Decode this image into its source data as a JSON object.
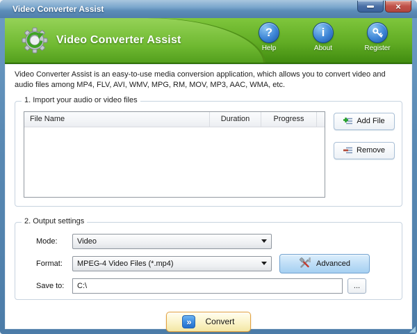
{
  "window": {
    "title": "Video Converter Assist"
  },
  "header": {
    "app_name": "Video Converter Assist",
    "nav": [
      {
        "label": "Help",
        "glyph": "?"
      },
      {
        "label": "About",
        "glyph": "i"
      },
      {
        "label": "Register",
        "glyph": ""
      }
    ]
  },
  "description": {
    "text": "Video Converter Assist is an easy-to-use media conversion application, which allows you to convert video and audio files among MP4, FLV, AVI, WMV, MPG, RM, MOV, MP3, AAC, WMA, etc."
  },
  "import_section": {
    "title": "1. Import your audio or video files",
    "columns": {
      "file_name": "File Name",
      "duration": "Duration",
      "progress": "Progress"
    },
    "rows": [],
    "add_file_label": "Add File",
    "remove_label": "Remove"
  },
  "output_section": {
    "title": "2. Output settings",
    "mode_label": "Mode:",
    "mode_value": "Video",
    "format_label": "Format:",
    "format_value": "MPEG-4 Video Files (*.mp4)",
    "advanced_label": "Advanced",
    "save_to_label": "Save to:",
    "save_to_value": "C:\\",
    "browse_label": "..."
  },
  "footer": {
    "convert_label": "Convert",
    "convert_glyph": "»"
  },
  "colors": {
    "titlebar_blue": "#5B8CB8",
    "header_green": "#61AC24",
    "accent_blue": "#2E78C8",
    "close_red": "#C05048",
    "convert_yellow": "#F3E7A4",
    "advanced_blue": "#BCDCF6"
  }
}
